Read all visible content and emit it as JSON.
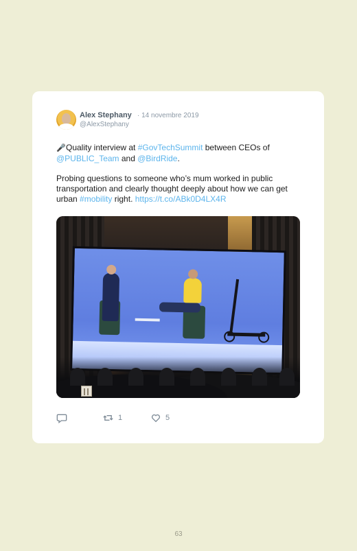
{
  "tweet": {
    "author_name": "Alex Stephany",
    "date": "· 14 novembre 2019",
    "handle": "@AlexStephany",
    "line1": {
      "emoji": "🎤",
      "prefix": "Quality interview at ",
      "hashtag1": "#GovTechSummit",
      "mid": " between CEOs of",
      "mention1": "@PUBLIC_Team",
      "and": " and ",
      "mention2": "@BirdRide",
      "end": "."
    },
    "line2": {
      "text": "Probing questions to someone who’s mum worked in public transportation and clearly thought deeply about how we can get urban ",
      "hashtag2": "#mobility",
      "after": " right. ",
      "link": "https://t.co/ABk0D4LX4R"
    },
    "actions": {
      "reply_count": "",
      "retweet_count": "1",
      "like_count": "5"
    }
  },
  "icons": {
    "reply": "reply-icon",
    "retweet": "retweet-icon",
    "like": "heart-icon",
    "gallery": "photo-gallery-icon"
  },
  "colors": {
    "link": "#5bb4ec",
    "background": "#eeeed6"
  },
  "page": {
    "number": "63"
  }
}
